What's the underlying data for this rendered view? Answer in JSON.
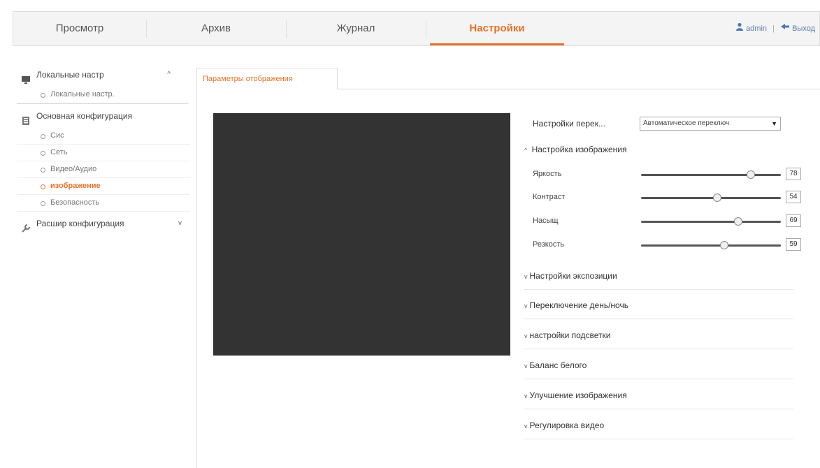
{
  "nav": {
    "tabs": [
      {
        "label": "Просмотр"
      },
      {
        "label": "Архив"
      },
      {
        "label": "Журнал"
      },
      {
        "label": "Настройки"
      }
    ],
    "user": "admin",
    "logout": "Выход",
    "user_separator": "|"
  },
  "sidebar": {
    "groups": [
      {
        "label": "Локальные настр",
        "chevron": "^",
        "items": [
          {
            "label": "Локальные настр."
          }
        ]
      },
      {
        "label": "Основная конфигурация",
        "chevron": "^",
        "items": [
          {
            "label": "Сис"
          },
          {
            "label": "Сеть"
          },
          {
            "label": "Видео/Аудио"
          },
          {
            "label": "изображение"
          },
          {
            "label": "Безопасность"
          }
        ]
      },
      {
        "label": "Расшир конфигурация",
        "chevron": "v"
      }
    ]
  },
  "main": {
    "tab_label": "Параметры отображения",
    "mode": {
      "label": "Настройки перек...",
      "value": "Автоматическое переключ"
    },
    "image_section": {
      "title": "Настройка изображения",
      "expand_symbol": "^",
      "sliders": [
        {
          "label": "Яркость",
          "value": "78",
          "level": 0.78
        },
        {
          "label": "Контраст",
          "value": "54",
          "level": 0.54
        },
        {
          "label": "Насыщ",
          "value": "69",
          "level": 0.69
        },
        {
          "label": "Резкость",
          "value": "59",
          "level": 0.59
        }
      ]
    },
    "collapse_symbol": "v",
    "collapsed_sections": [
      {
        "label": "Настройки экспозиции"
      },
      {
        "label": "Переключение день/ночь"
      },
      {
        "label": "настройки подсветки"
      },
      {
        "label": "Баланс белого"
      },
      {
        "label": "Улучшение изображения"
      },
      {
        "label": "Регулировка видео"
      }
    ]
  },
  "colors": {
    "accent": "#e8722a",
    "video_bg": "#333333"
  }
}
